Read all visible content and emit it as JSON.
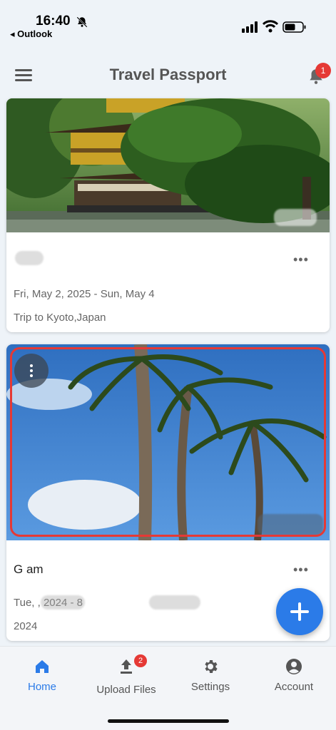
{
  "status_bar": {
    "time": "16:40",
    "back_app": "◂ Outlook"
  },
  "app_bar": {
    "title": "Travel Passport",
    "notification_count": "1"
  },
  "trips": [
    {
      "name": "",
      "more": "•••",
      "dates": "Fri, May 2, 2025 - Sun, May 4",
      "description": "Trip to Kyoto,Japan"
    },
    {
      "name": "G  am",
      "more": "•••",
      "dates": "Tue,              , 2024 -                8",
      "description": "2024"
    }
  ],
  "bottom_nav": {
    "items": [
      {
        "label": "Home",
        "icon": "home-icon",
        "active": true
      },
      {
        "label": "Upload Files",
        "icon": "upload-icon",
        "badge": "2"
      },
      {
        "label": "Settings",
        "icon": "gear-icon"
      },
      {
        "label": "Account",
        "icon": "account-icon"
      }
    ]
  },
  "colors": {
    "accent": "#2b7be8",
    "badge": "#e53935",
    "highlight": "#e53935"
  }
}
